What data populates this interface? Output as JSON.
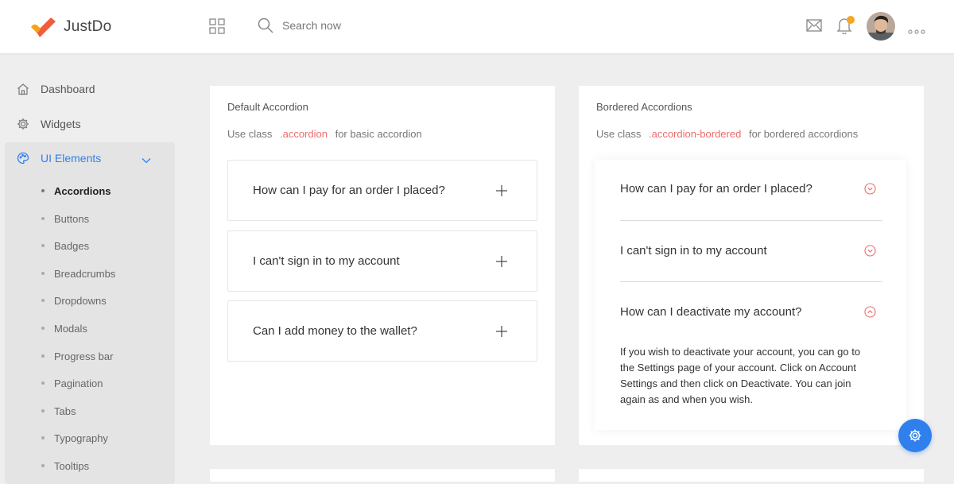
{
  "app": {
    "name": "JustDo"
  },
  "search": {
    "placeholder": "Search now"
  },
  "sidebar": {
    "items": [
      {
        "label": "Dashboard",
        "icon": "home-icon"
      },
      {
        "label": "Widgets",
        "icon": "gear-icon"
      },
      {
        "label": "UI Elements",
        "icon": "palette-icon",
        "active": true
      }
    ],
    "sub_items": [
      "Accordions",
      "Buttons",
      "Badges",
      "Breadcrumbs",
      "Dropdowns",
      "Modals",
      "Progress bar",
      "Pagination",
      "Tabs",
      "Typography",
      "Tooltips"
    ],
    "active_sub": "Accordions"
  },
  "default_card": {
    "title": "Default Accordion",
    "desc_prefix": "Use class",
    "class_name": ".accordion",
    "desc_suffix": "for basic accordion",
    "items": [
      "How can I pay for an order I placed?",
      "I can't sign in to my account",
      "Can I add money to the wallet?"
    ]
  },
  "bordered_card": {
    "title": "Bordered Accordions",
    "desc_prefix": "Use class",
    "class_name": ".accordion-bordered",
    "desc_suffix": "for bordered accordions",
    "items": [
      "How can I pay for an order I placed?",
      "I can't sign in to my account",
      "How can I deactivate my account?"
    ],
    "open_answer": "If you wish to deactivate your account, you can go to the Settings page of your account. Click on Account Settings and then click on Deactivate. You can join again as and when you wish."
  },
  "colors": {
    "accent": "#2f80ed",
    "code": "#ec6b6b",
    "notification": "#f5a623",
    "logo_orange": "#f7a21b",
    "logo_red": "#ef5d3c"
  }
}
